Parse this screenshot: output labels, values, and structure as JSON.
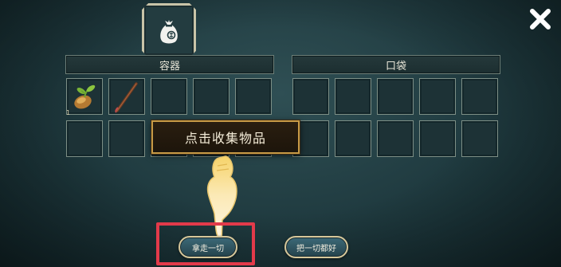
{
  "header": {
    "container_label": "容器",
    "pocket_label": "口袋"
  },
  "container": {
    "slots": [
      {
        "item": "sprouting-seed-icon",
        "qty": "1"
      },
      {
        "item": "wooden-staff-icon",
        "qty": ""
      },
      {
        "item": "",
        "qty": ""
      },
      {
        "item": "",
        "qty": ""
      },
      {
        "item": "",
        "qty": ""
      },
      {
        "item": "",
        "qty": ""
      },
      {
        "item": "",
        "qty": ""
      },
      {
        "item": "",
        "qty": ""
      },
      {
        "item": "",
        "qty": ""
      },
      {
        "item": "",
        "qty": ""
      }
    ]
  },
  "tooltip": {
    "text": "点击收集物品"
  },
  "buttons": {
    "take_all": "拿走一切",
    "put_all": "把一切都好"
  },
  "colors": {
    "background": "#1f3a3f",
    "tooltip_border": "#c79a46",
    "highlight": "#e23a4a",
    "button_border": "#d6c79a"
  }
}
